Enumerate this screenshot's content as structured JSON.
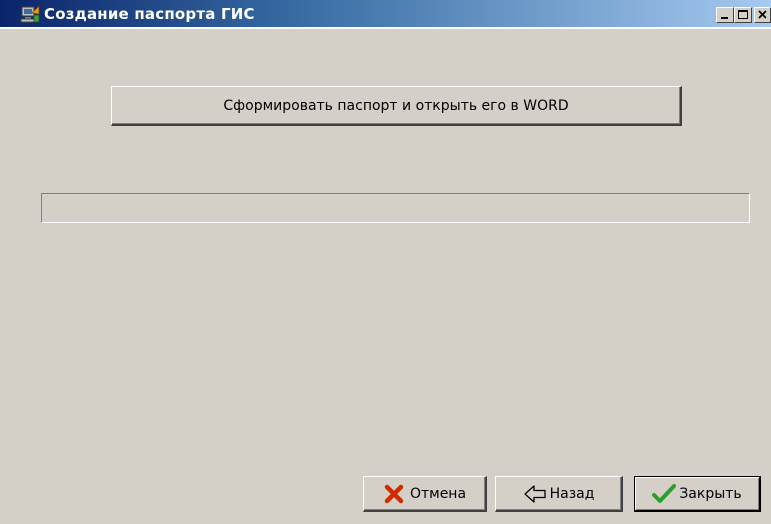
{
  "window": {
    "title": "Создание паспорта ГИС",
    "icon": "setup-computer-icon",
    "controls": {
      "minimize": "minimize-icon",
      "maximize": "maximize-icon",
      "close": "close-icon"
    }
  },
  "main": {
    "generate_button_label": "Сформировать паспорт и открыть его в WORD",
    "progress": 0
  },
  "footer": {
    "cancel_label": "Отмена",
    "cancel_icon": "red-x-icon",
    "back_label": "Назад",
    "back_icon": "left-arrow-icon",
    "close_label": "Закрыть",
    "close_icon": "green-check-icon"
  },
  "colors": {
    "titlebar_start": "#0a246a",
    "titlebar_end": "#a6caf0",
    "face": "#d4d0c8",
    "cancel_icon": "#d42a00",
    "check_icon": "#2aa02a"
  }
}
